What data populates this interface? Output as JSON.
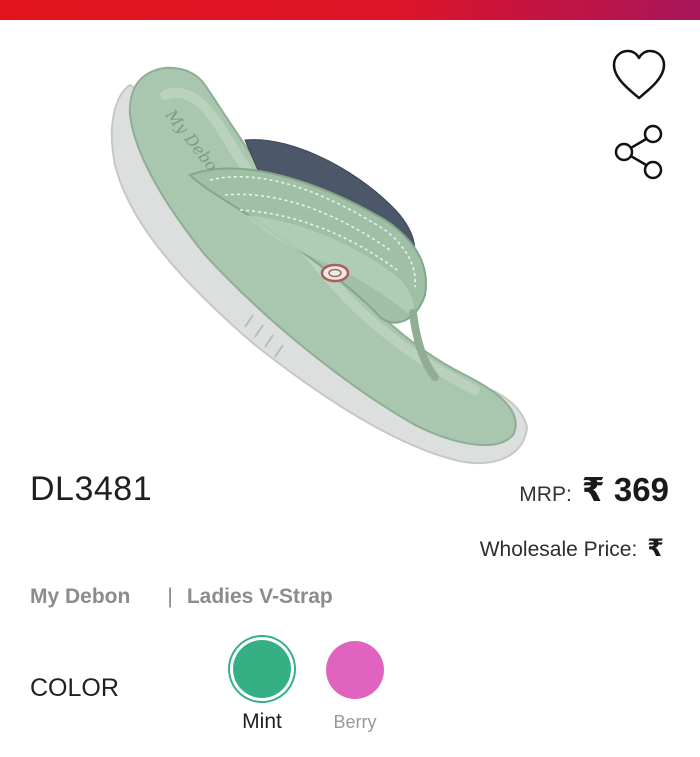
{
  "header": {
    "bar_color": "#e3141d"
  },
  "actions": {
    "wishlist_icon": "heart-icon",
    "share_icon": "share-icon"
  },
  "product": {
    "code": "DL3481",
    "mrp_label": "MRP:",
    "mrp_value": "₹ 369",
    "wholesale_label": "Wholesale Price:",
    "wholesale_value": "₹",
    "brand": "My Debon",
    "separator": "|",
    "category": "Ladies V-Strap",
    "image_brand_text": "My Debon"
  },
  "colors": {
    "title": "COLOR",
    "options": [
      {
        "label": "Mint",
        "hex": "#35b085",
        "selected": true
      },
      {
        "label": "Berry",
        "hex": "#e064bf",
        "selected": false
      }
    ]
  }
}
